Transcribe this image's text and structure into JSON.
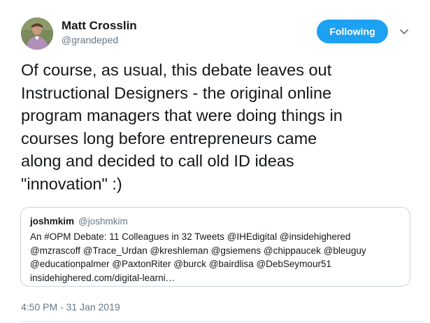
{
  "author": {
    "name": "Matt Crosslin",
    "handle": "@grandeped"
  },
  "follow_button": {
    "label": "Following",
    "color": "#1da1f2"
  },
  "menu_icon": "chevron-down-icon",
  "tweet": {
    "text": "Of course, as usual, this debate leaves out\nInstructional Designers - the original online\nprogram managers that were doing things in\ncourses long before entrepreneurs came\nalong and decided to call old ID ideas\n\"innovation\" :)",
    "timestamp": "4:50 PM - 31 Jan 2019"
  },
  "quoted_tweet": {
    "name": "joshmkim",
    "handle": "@joshmkim",
    "text": "An #OPM Debate: 11 Colleagues in 32 Tweets @IHEdigital @insidehighered\n@mzrascoff @Trace_Urdan @kreshleman @gsiemens @chippaucek @bleuguy\n@educationpalmer @PaxtonRiter @burck @bairdlisa @DebSeymour51\ninsidehighered.com/digital-learni…"
  },
  "colors": {
    "primary_text": "#14171a",
    "secondary_text": "#657786",
    "border": "#ccd6dd"
  }
}
